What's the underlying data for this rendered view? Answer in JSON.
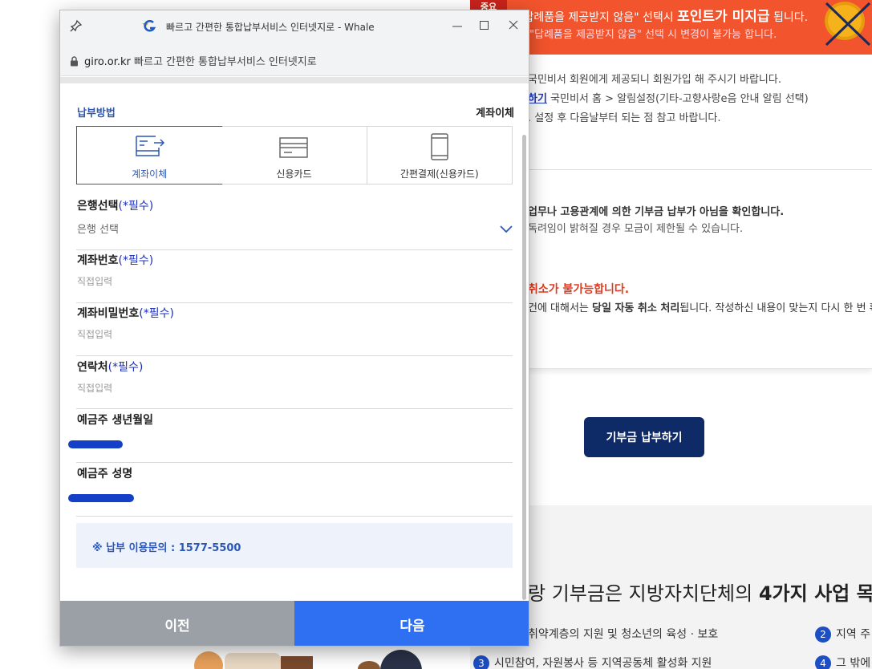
{
  "background": {
    "banner": {
      "tag": "중요",
      "line1_pre": "\"답례품을 제공받지 않음\" 선택시 ",
      "line1_bold": "포인트가 미지급",
      "line1_post": " 됩니다.",
      "line2": "\"답례품을 제공받지 않음\" 선택 시 변경이 불가능 합니다."
    },
    "notice1": {
      "line1": "국민비서 회원에게 제공되니 회원가입 해 주시기 바랍니다.",
      "line2_link": "하기",
      "line2_text": " 국민비서 홈 > 알림설정(기타-고향사랑e음 안내 알림 선택)",
      "line3": ". 설정 후 다음날부터 되는 점 참고 바랍니다."
    },
    "notice2": {
      "line1": "업무나 고용관계에 의한 기부금 납부가 아님을 확인합니다.",
      "line2": "독려임이 밝혀질 경우 모금이 제한될 수 있습니다.",
      "line3": "취소가 불가능합니다.",
      "line4_pre": "건에 대해서는 ",
      "line4_bold": "당일 자동 취소 처리",
      "line4_post": "됩니다. 작성하신 내용이 맞는지 다시 한 번 확인"
    },
    "donate_button": "기부금 납부하기",
    "section3": {
      "heading_pre": "랑 기부금은 지방자치단체의 ",
      "heading_bold": "4가지 사업 목",
      "items": [
        {
          "num": "",
          "text": "취약계층의 지원 및 청소년의 육성 · 보호"
        },
        {
          "num": "2",
          "text": "지역 주"
        },
        {
          "num": "3",
          "text": "시민참여, 자원봉사 등 지역공동체 활성화 지원"
        },
        {
          "num": "4",
          "text": "그 밖에"
        }
      ]
    }
  },
  "window": {
    "title": "빠르고 간편한 통합납부서비스 인터넷지로 - Whale",
    "url_domain": "giro.or.kr",
    "url_title": "빠르고 간편한 통합납부서비스 인터넷지로"
  },
  "form": {
    "payment_method_label": "납부방법",
    "payment_method_value": "계좌이체",
    "methods": [
      {
        "label": "계좌이체",
        "active": true
      },
      {
        "label": "신용카드",
        "active": false
      },
      {
        "label": "간편결제(신용카드)",
        "active": false
      }
    ],
    "required_mark": "(*필수)",
    "bank": {
      "label": "은행선택",
      "value": "은행 선택"
    },
    "account_number": {
      "label": "계좌번호",
      "placeholder": "직접입력"
    },
    "account_password": {
      "label": "계좌비밀번호",
      "placeholder": "직접입력"
    },
    "contact": {
      "label": "연락처",
      "placeholder": "직접입력"
    },
    "birth_date": {
      "label": "예금주 생년월일"
    },
    "holder_name": {
      "label": "예금주 성명"
    },
    "inquiry": "※ 납부 이용문의 : 1577-5500",
    "prev_button": "이전",
    "next_button": "다음"
  },
  "colors": {
    "accent": "#2c57b8",
    "next_button": "#2f6ff1",
    "prev_button": "#9aa0a6",
    "banner": "#f2542d",
    "required": "#1a2fb8"
  }
}
